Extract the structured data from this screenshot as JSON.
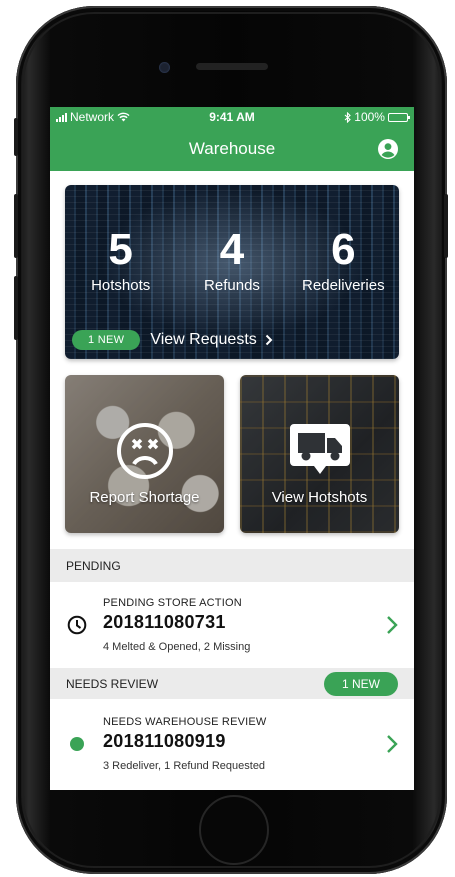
{
  "status_bar": {
    "carrier": "Network",
    "time": "9:41 AM",
    "battery": "100%"
  },
  "nav": {
    "title": "Warehouse",
    "account_icon": "user-circle-icon"
  },
  "summary": {
    "stats": [
      {
        "value": "5",
        "label": "Hotshots"
      },
      {
        "value": "4",
        "label": "Refunds"
      },
      {
        "value": "6",
        "label": "Redeliveries"
      }
    ],
    "new_badge": "1 NEW",
    "view_requests_label": "View Requests"
  },
  "tiles": {
    "report_shortage": {
      "label": "Report Shortage",
      "icon": "sad-face-icon"
    },
    "view_hotshots": {
      "label": "View Hotshots",
      "icon": "truck-icon"
    }
  },
  "sections": {
    "pending": {
      "header": "PENDING",
      "item": {
        "icon": "clock-icon",
        "category": "PENDING STORE ACTION",
        "id": "201811080731",
        "detail": "4 Melted & Opened, 2 Missing"
      }
    },
    "review": {
      "header": "NEEDS REVIEW",
      "badge": "1 NEW",
      "item": {
        "icon": "green-dot-icon",
        "category": "NEEDS WAREHOUSE REVIEW",
        "id": "201811080919",
        "detail": "3 Redeliver, 1 Refund Requested"
      }
    }
  },
  "colors": {
    "brand_green": "#3aa356",
    "section_gray": "#ebebeb"
  }
}
